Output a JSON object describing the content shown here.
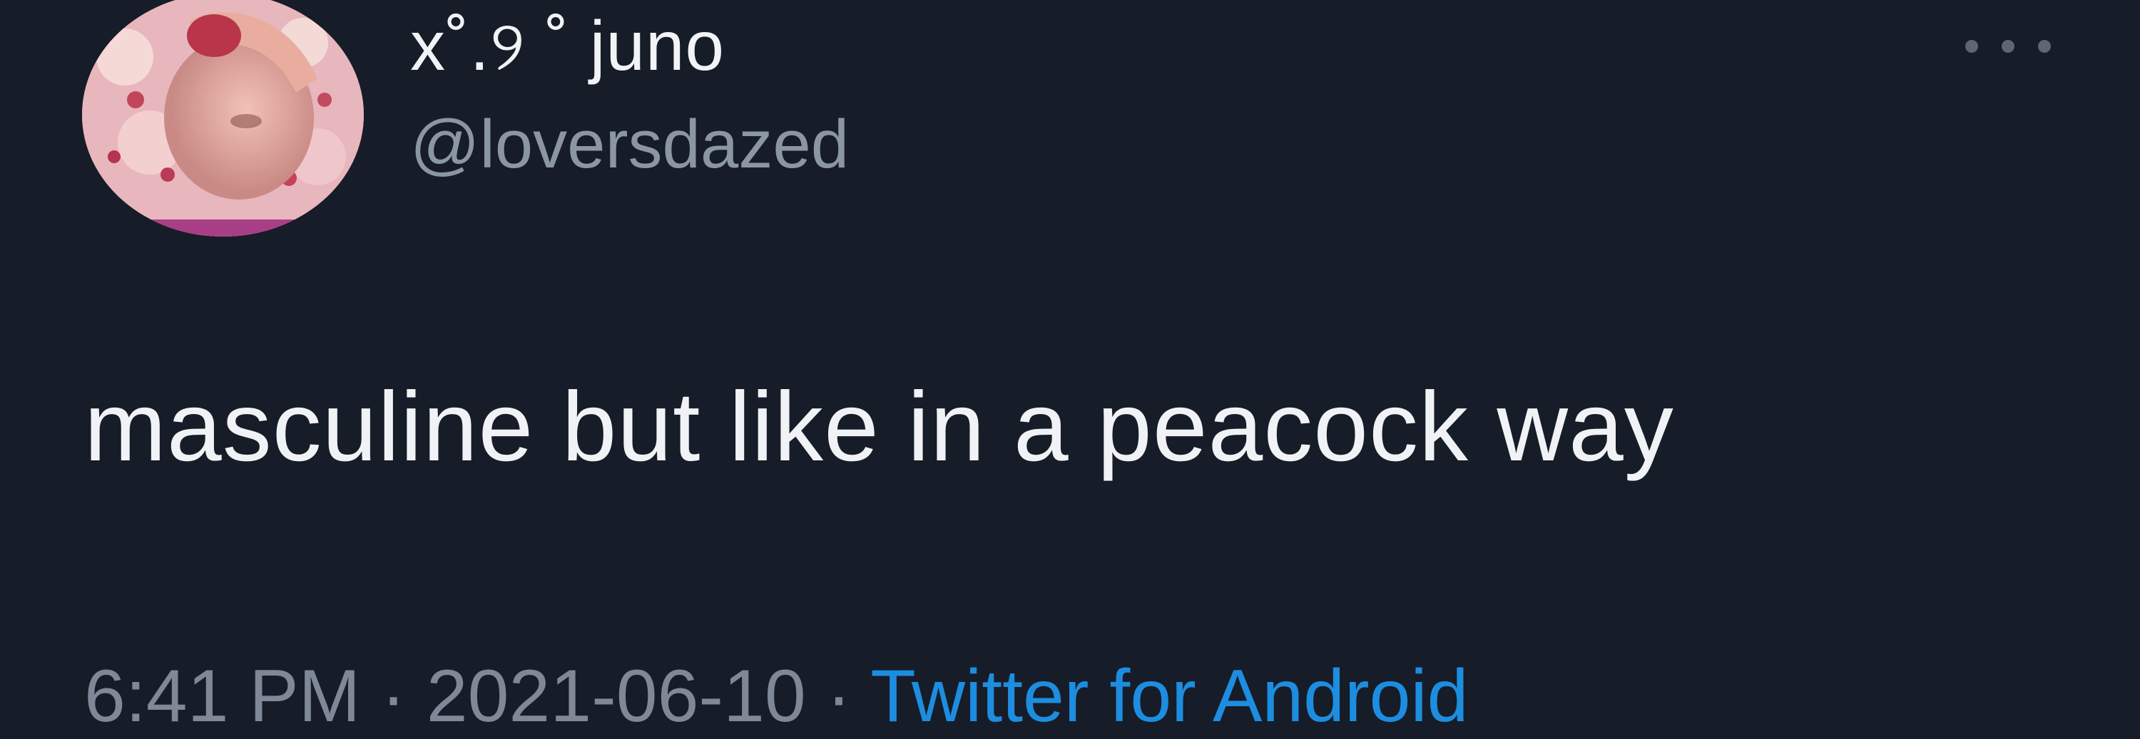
{
  "tweet": {
    "display_name": "x˚.୨ ˚ juno",
    "handle": "@loversdazed",
    "text": "masculine but like in a peacock way",
    "time": "6:41 PM",
    "separator": " · ",
    "date": "2021-06-10",
    "source": "Twitter for Android"
  },
  "icons": {
    "more": "more-horizontal-icon",
    "avatar": "profile-photo"
  },
  "colors": {
    "background": "#161c28",
    "text_primary": "#f1f2f5",
    "text_secondary": "#8b96a5",
    "link": "#1d8de0"
  }
}
